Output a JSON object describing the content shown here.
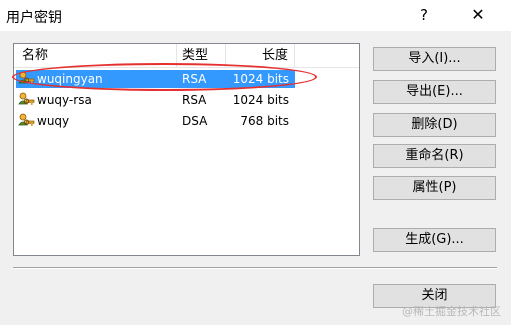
{
  "window": {
    "title": "用户密钥",
    "help_label": "?",
    "close_label": "✕"
  },
  "list": {
    "columns": {
      "name": "名称",
      "type": "类型",
      "length": "长度"
    },
    "rows": [
      {
        "name": "wuqingyan",
        "type": "RSA",
        "length": "1024 bits",
        "selected": true,
        "icon": "key-user-icon"
      },
      {
        "name": "wuqy-rsa",
        "type": "RSA",
        "length": "1024 bits",
        "selected": false,
        "icon": "key-user-icon"
      },
      {
        "name": "wuqy",
        "type": "DSA",
        "length": "768 bits",
        "selected": false,
        "icon": "key-user-icon"
      }
    ]
  },
  "buttons": {
    "import": "导入(I)...",
    "export": "导出(E)...",
    "delete": "删除(D)",
    "rename": "重命名(R)",
    "properties": "属性(P)",
    "generate": "生成(G)...",
    "close": "关闭"
  },
  "watermark": "@稀土掘金技术社区",
  "colors": {
    "selection": "#3399ff",
    "annotation": "#e53030",
    "button_face": "#e1e1e1"
  }
}
